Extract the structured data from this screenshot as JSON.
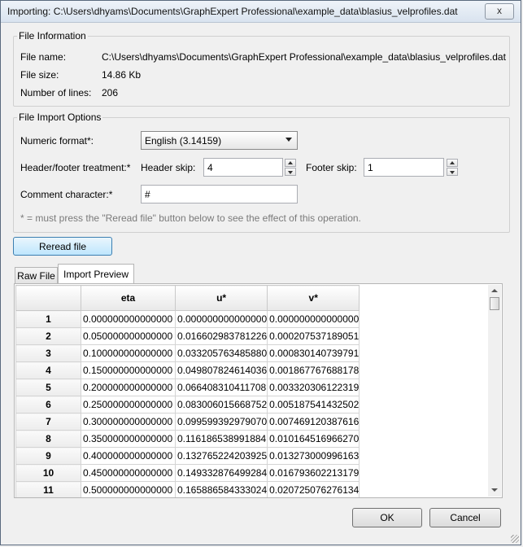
{
  "window": {
    "title": "Importing: C:\\Users\\dhyams\\Documents\\GraphExpert Professional\\example_data\\blasius_velprofiles.dat",
    "close": "x"
  },
  "file_info": {
    "heading": "File Information",
    "name_label": "File name:",
    "name_value": "C:\\Users\\dhyams\\Documents\\GraphExpert Professional\\example_data\\blasius_velprofiles.dat",
    "size_label": "File size:",
    "size_value": "14.86 Kb",
    "lines_label": "Number of lines:",
    "lines_value": "206"
  },
  "import_options": {
    "heading": "File Import Options",
    "numeric_label": "Numeric format*:",
    "numeric_value": "English (3.14159)",
    "hf_label": "Header/footer treatment:*",
    "header_skip_label": "Header skip:",
    "header_skip_value": "4",
    "footer_skip_label": "Footer skip:",
    "footer_skip_value": "1",
    "comment_label": "Comment character:*",
    "comment_value": "#",
    "note": "* = must press the \"Reread file\" button below to see the effect of this operation."
  },
  "reread_label": "Reread file",
  "tabs": [
    "Raw File",
    "Import Preview"
  ],
  "table": {
    "columns": [
      "eta",
      "u*",
      "v*"
    ],
    "rows": [
      {
        "n": "1",
        "eta": "0.000000000000000",
        "u": "0.000000000000000",
        "v": "0.000000000000000"
      },
      {
        "n": "2",
        "eta": "0.050000000000000",
        "u": "0.016602983781226",
        "v": "0.000207537189051"
      },
      {
        "n": "3",
        "eta": "0.100000000000000",
        "u": "0.033205763485880",
        "v": "0.000830140739791"
      },
      {
        "n": "4",
        "eta": "0.150000000000000",
        "u": "0.049807824614036",
        "v": "0.001867767688178"
      },
      {
        "n": "5",
        "eta": "0.200000000000000",
        "u": "0.066408310411708",
        "v": "0.003320306122319"
      },
      {
        "n": "6",
        "eta": "0.250000000000000",
        "u": "0.083006015668752",
        "v": "0.005187541432502"
      },
      {
        "n": "7",
        "eta": "0.300000000000000",
        "u": "0.099599392979070",
        "v": "0.007469120387616"
      },
      {
        "n": "8",
        "eta": "0.350000000000000",
        "u": "0.116186538991884",
        "v": "0.010164516966270"
      },
      {
        "n": "9",
        "eta": "0.400000000000000",
        "u": "0.132765224203925",
        "v": "0.013273000996163"
      },
      {
        "n": "10",
        "eta": "0.450000000000000",
        "u": "0.149332876499284",
        "v": "0.016793602213179"
      },
      {
        "n": "11",
        "eta": "0.500000000000000",
        "u": "0.165886584333024",
        "v": "0.020725076276134"
      }
    ]
  },
  "buttons": {
    "ok": "OK",
    "cancel": "Cancel"
  }
}
